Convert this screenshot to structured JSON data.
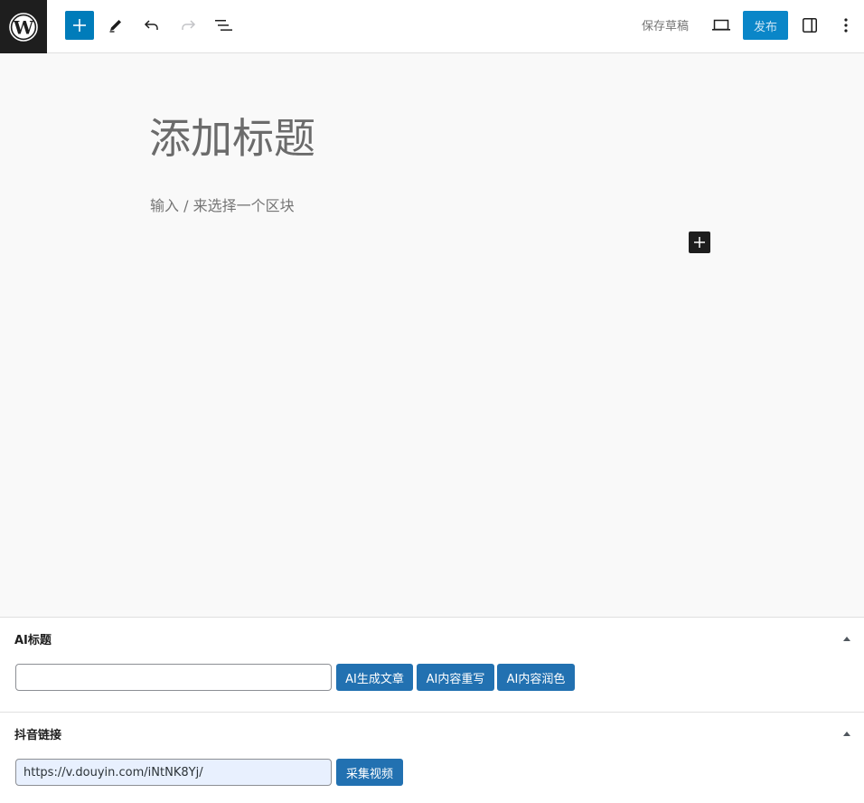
{
  "toolbar": {
    "save_draft": "保存草稿",
    "publish": "发布",
    "icons": [
      "wordpress-logo",
      "plus",
      "pencil",
      "undo",
      "redo",
      "list-view",
      "preview-laptop",
      "sidebar-toggle",
      "kebab-menu"
    ]
  },
  "editor": {
    "title_placeholder": "添加标题",
    "block_placeholder": "输入 / 来选择一个区块"
  },
  "meta_boxes": {
    "ai": {
      "title": "AI标题",
      "input_value": "",
      "buttons": [
        "AI生成文章",
        "AI内容重写",
        "AI内容润色"
      ]
    },
    "douyin": {
      "title": "抖音链接",
      "input_value": "https://v.douyin.com/iNtNK8Yj/",
      "button": "采集视频"
    }
  },
  "colors": {
    "accent": "#007cba",
    "button": "#2271b1",
    "dark": "#1e1e1e"
  }
}
